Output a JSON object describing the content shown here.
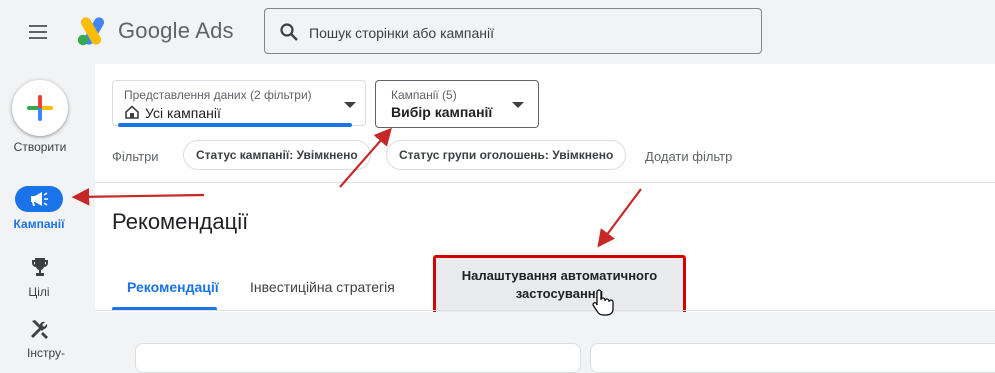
{
  "header": {
    "brand": "Google Ads",
    "search": {
      "placeholder": "Пошук сторінки або кампанії"
    }
  },
  "rail": {
    "create_label": "Створити",
    "items": [
      {
        "label": "Кампанії",
        "icon": "megaphone-icon",
        "active": true
      },
      {
        "label": "Цілі",
        "icon": "trophy-icon",
        "active": false
      },
      {
        "label": "Інстру-",
        "icon": "tools-icon",
        "active": false
      }
    ]
  },
  "views": {
    "data_view": {
      "label": "Представлення даних (2 фільтри)",
      "value": "Усі кампанії"
    },
    "campaigns": {
      "label": "Кампанії (5)",
      "value": "Вибір кампанії"
    }
  },
  "filters": {
    "label": "Фільтри",
    "chips": [
      "Статус кампанії: Увімкнено",
      "Статус групи оголошень: Увімкнено"
    ],
    "add": "Додати фільтр"
  },
  "page": {
    "title": "Рекомендації"
  },
  "tabs": [
    {
      "label": "Рекомендації",
      "active": true
    },
    {
      "label": "Інвестиційна стратегія",
      "active": false
    },
    {
      "label": "Налаштування автоматичного застосування",
      "active": false,
      "highlighted": true
    }
  ],
  "colors": {
    "accent": "#1a73e8",
    "annotation": "#d50000"
  }
}
